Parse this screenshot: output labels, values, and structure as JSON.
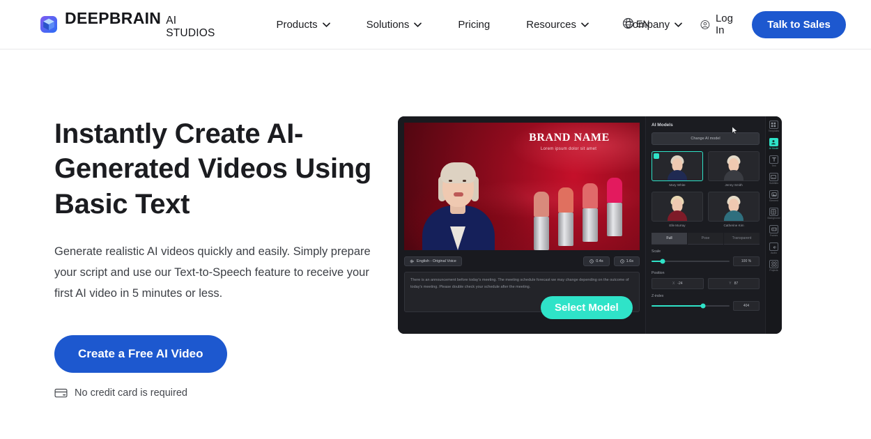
{
  "header": {
    "brand": {
      "name": "DEEPBRAIN",
      "sub": "AI STUDIOS",
      "icon": "cube-logo-icon"
    },
    "nav": [
      {
        "label": "Products",
        "has_caret": true
      },
      {
        "label": "Solutions",
        "has_caret": true
      },
      {
        "label": "Pricing",
        "has_caret": false
      },
      {
        "label": "Resources",
        "has_caret": true
      },
      {
        "label": "Company",
        "has_caret": true
      }
    ],
    "language": {
      "label": "EN",
      "icon": "globe-icon"
    },
    "login": {
      "label": "Log In",
      "icon": "user-circle-icon"
    },
    "cta": {
      "label": "Talk to Sales",
      "color": "#1d58cf"
    }
  },
  "hero": {
    "title": "Instantly Create AI-Generated Videos Using Basic Text",
    "subtitle": "Generate realistic AI videos quickly and easily. Simply prepare your script and use our Text-to-Speech feature to receive your first AI video in 5 minutes or less.",
    "cta": {
      "label": "Create a Free AI Video",
      "color": "#1d58cf"
    },
    "note": {
      "label": "No credit card is required",
      "icon": "credit-card-icon"
    }
  },
  "mockup": {
    "video": {
      "brand_title": "BRAND NAME",
      "brand_subtitle": "Lorem ipsum dolor sit amet",
      "lipstick_colors": [
        "#d98a7c",
        "#e0705f",
        "#e06a6a",
        "#e31a5e"
      ]
    },
    "voicebar": {
      "voice_label": "English - Original Voice",
      "voice_icon": "waveform-icon",
      "time_start": "0.4s",
      "time_end": "1.6s",
      "clock_icon": "clock-icon"
    },
    "script": "There is an announcement before today's meeting. The meeting schedule forecast we may change depending on the outcome of today's meeting. Please double check your schedule after the meeting.",
    "panel": {
      "title": "AI Models",
      "change_button": "Change AI model",
      "models": [
        {
          "label": "Mary White",
          "selected": true,
          "hair": "#ddd2c2",
          "body": "#1f2a52"
        },
        {
          "label": "Jenny Smith",
          "selected": false,
          "hair": "#e4dac9",
          "body": "#3a3c42"
        },
        {
          "label": "Elle Murray",
          "selected": false,
          "hair": "#e8d7b2",
          "body": "#7e1b28"
        },
        {
          "label": "Catherine Kim",
          "selected": false,
          "hair": "#e6dcc8",
          "body": "#2f6f7e"
        }
      ],
      "tabs": [
        {
          "label": "Full",
          "active": true
        },
        {
          "label": "Pose",
          "active": false
        },
        {
          "label": "Transparent",
          "active": false
        }
      ],
      "controls": [
        {
          "label": "Scale",
          "value": "100 %",
          "fill_pct": 14
        },
        {
          "label": "Z-index",
          "value": "404",
          "fill_pct": 66
        }
      ],
      "position": {
        "label": "Position",
        "x_key": "X",
        "x_value": "-24",
        "y_key": "Y",
        "y_value": "87"
      }
    },
    "rail": [
      {
        "label": "Templates",
        "icon": "templates-icon",
        "active": false
      },
      {
        "label": "AI Model",
        "icon": "ai-model-icon",
        "active": true
      },
      {
        "label": "Text",
        "icon": "text-icon",
        "active": false
      },
      {
        "label": "Subtitles",
        "icon": "subtitles-icon",
        "active": false
      },
      {
        "label": "Element",
        "icon": "element-icon",
        "active": false
      },
      {
        "label": "Background",
        "icon": "background-icon",
        "active": false
      },
      {
        "label": "Frames",
        "icon": "frames-icon",
        "active": false
      },
      {
        "label": "Audio",
        "icon": "audio-icon",
        "active": false
      },
      {
        "label": "Projects",
        "icon": "projects-icon",
        "active": false
      }
    ],
    "tooltip": {
      "label": "Select Model",
      "color": "#2fe3c8"
    },
    "cursor_icon": "mouse-pointer-icon"
  }
}
